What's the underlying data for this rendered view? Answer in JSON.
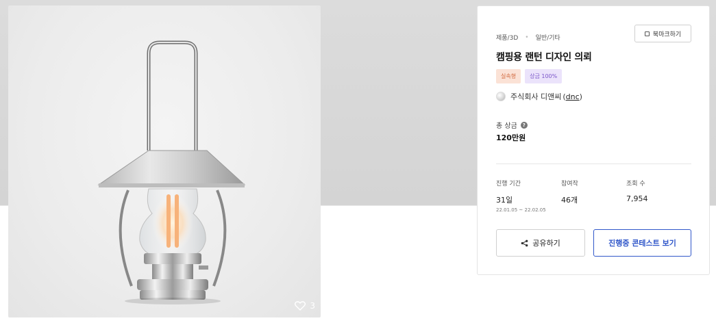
{
  "hero": {
    "image_alt": "lantern-render",
    "like_count": "3"
  },
  "panel": {
    "category": {
      "primary": "제품/3D",
      "separator": "•",
      "secondary": "일반/기타"
    },
    "bookmark_label": "북마크하기",
    "title": "캠핑용 랜턴 디자인 의뢰",
    "badges": {
      "type": "실속형",
      "prize": "상금 100%"
    },
    "company": {
      "name": "주식회사 디앤씨",
      "handle": "dnc",
      "paren_open": "(",
      "paren_close": ")"
    },
    "prize": {
      "label": "총 상금",
      "help": "?",
      "value": "120만원"
    },
    "stats": {
      "period": {
        "label": "진행 기간",
        "value": "31일",
        "range": "22.01.05 ~ 22.02.05"
      },
      "participants": {
        "label": "참여작",
        "value": "46개"
      },
      "views": {
        "label": "조회 수",
        "value": "7,954"
      }
    },
    "actions": {
      "share_label": "공유하기",
      "contest_label": "진행중 콘테스트 보기"
    }
  },
  "colors": {
    "accent": "#2f56c9",
    "badge_type_bg": "#fbe2d6",
    "badge_prize_bg": "#ebe3fb"
  }
}
